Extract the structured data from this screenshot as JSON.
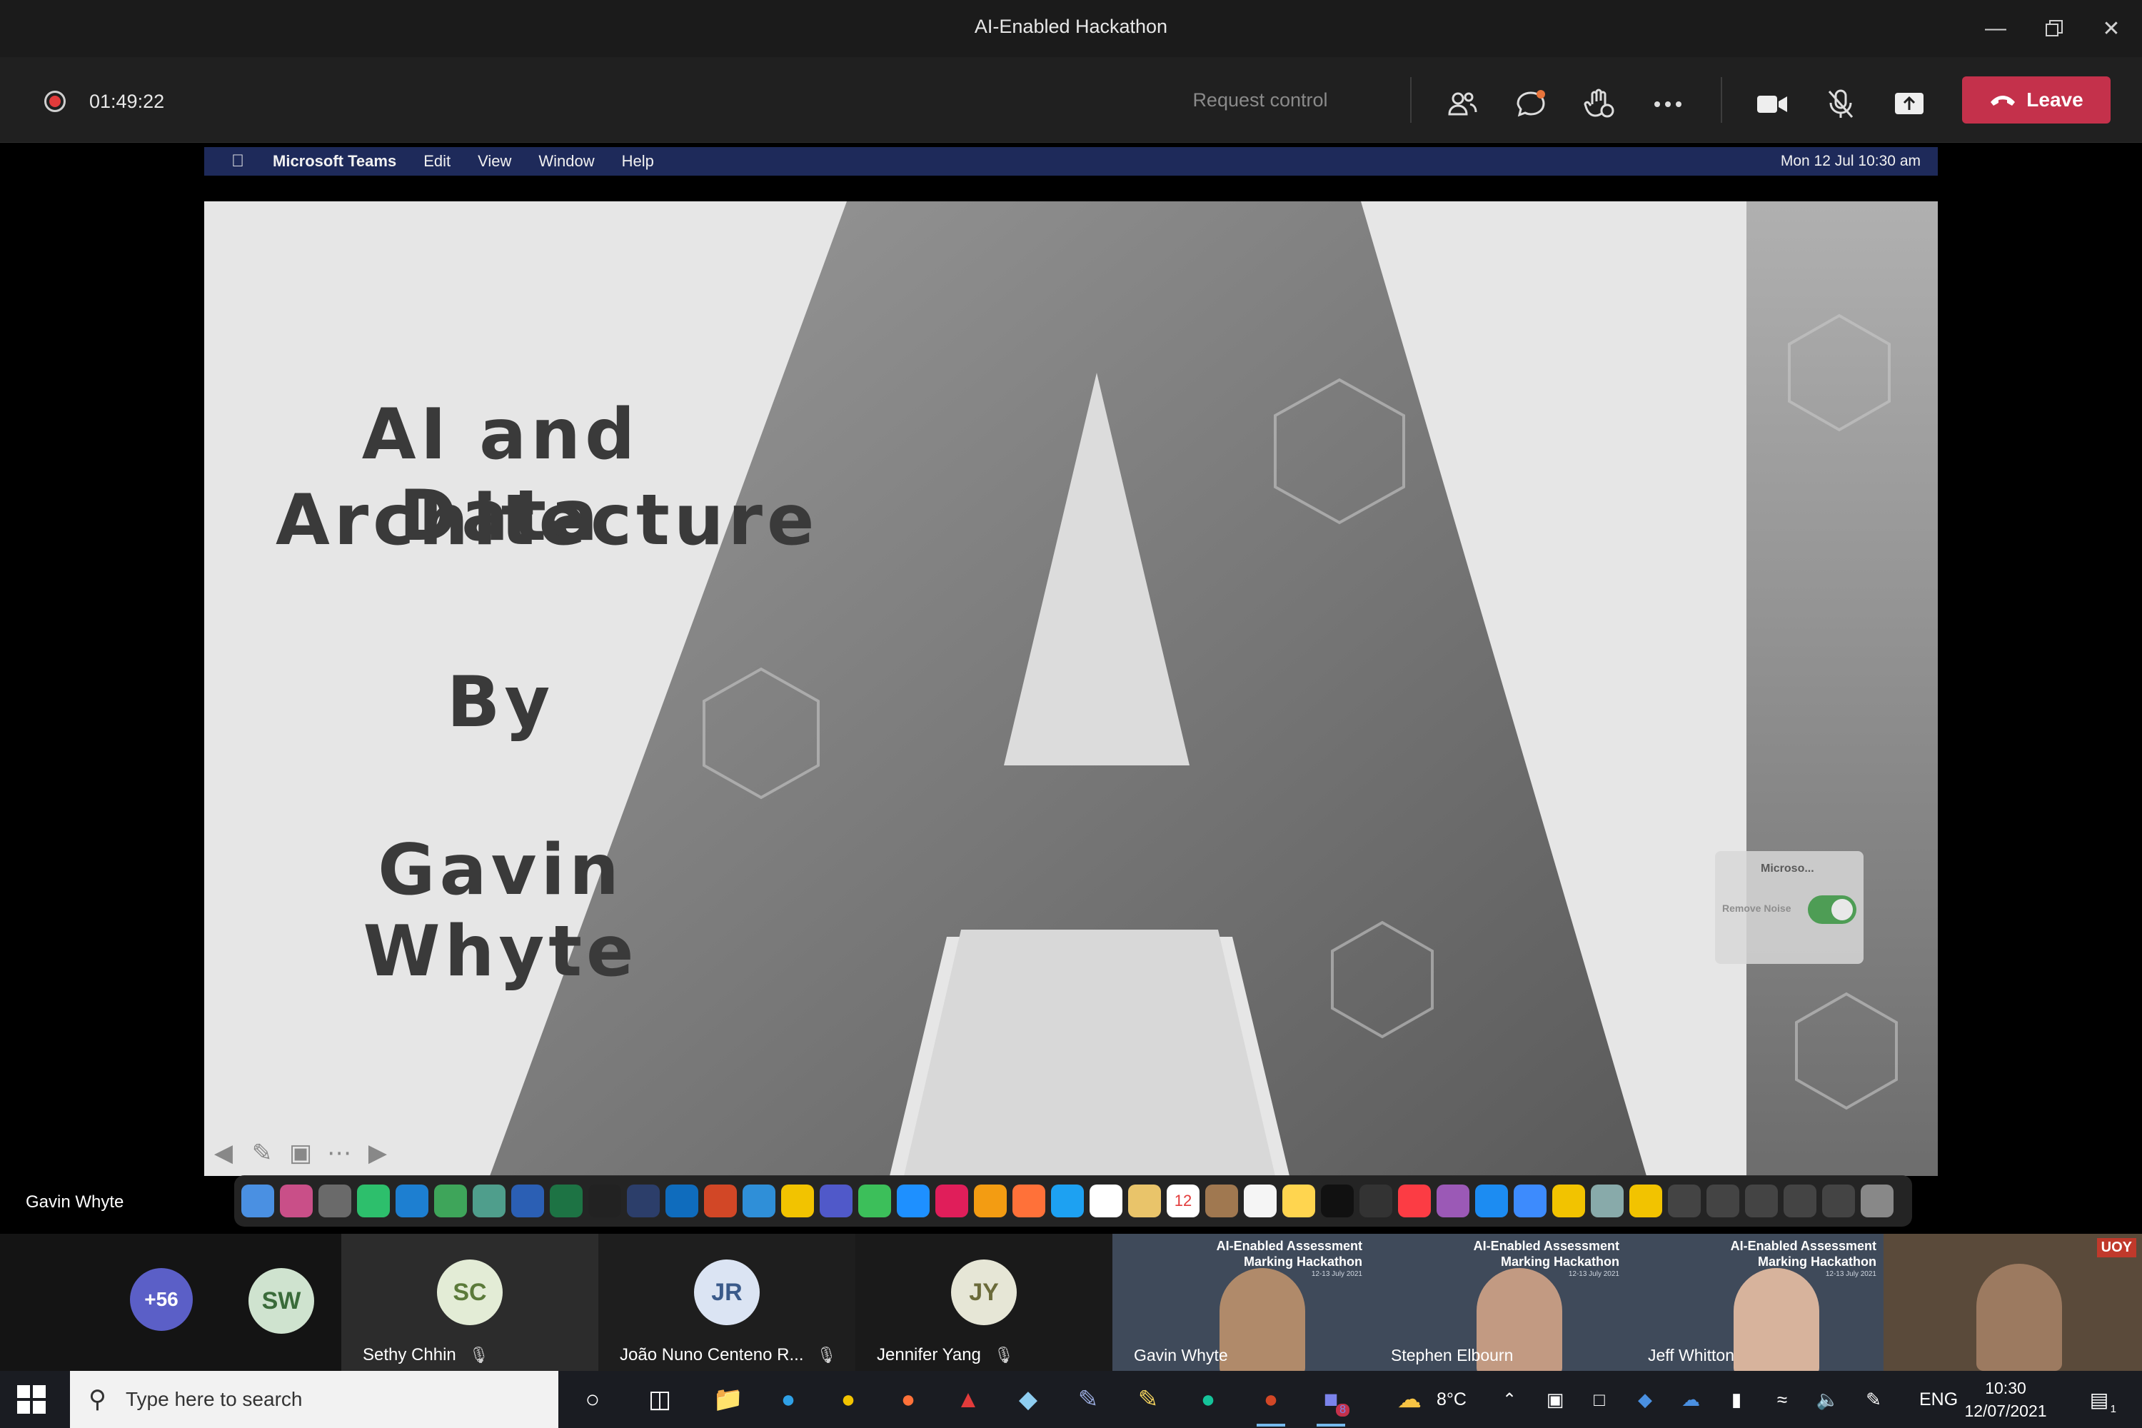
{
  "window": {
    "title": "AI-Enabled Hackathon",
    "controls": [
      "minimize-icon",
      "restore-icon",
      "close-icon"
    ]
  },
  "toolbar": {
    "recording_time": "01:49:22",
    "request_control": "Request control",
    "leave_label": "Leave",
    "icons": [
      "participants-icon",
      "chat-icon",
      "reactions-icon",
      "more-options-icon",
      "camera-icon",
      "mic-muted-icon",
      "share-screen-icon"
    ],
    "leave_color": "#c4314b"
  },
  "shared_screen": {
    "mac_menubar": {
      "app": "Microsoft Teams",
      "menus": [
        "Edit",
        "View",
        "Window",
        "Help"
      ],
      "datetime": "Mon 12 Jul 10:30 am"
    },
    "slide": {
      "title_line1": "AI and Data",
      "title_line2": "Architecture",
      "by": "By",
      "author": "Gavin Whyte"
    },
    "noise_panel": {
      "app": "Microso...",
      "label": "Remove Noise"
    },
    "dock_badge": "12",
    "speaker_name": "Gavin Whyte"
  },
  "participants": {
    "overflow": "+56",
    "tiles": [
      {
        "initials": "SW",
        "name": ""
      },
      {
        "initials": "SC",
        "name": "Sethy Chhin"
      },
      {
        "initials": "JR",
        "name": "João Nuno Centeno R..."
      },
      {
        "initials": "JY",
        "name": "Jennifer Yang"
      }
    ],
    "videos": [
      {
        "name": "Gavin Whyte",
        "banner_title": "AI-Enabled Assessment",
        "banner_line2": "Marking Hackathon",
        "banner_dates": "12-13 July 2021"
      },
      {
        "name": "Stephen Elbourn",
        "banner_title": "AI-Enabled Assessment",
        "banner_line2": "Marking Hackathon",
        "banner_dates": "12-13 July 2021"
      },
      {
        "name": "Jeff Whitton",
        "banner_title": "AI-Enabled Assessment",
        "banner_line2": "Marking Hackathon",
        "banner_dates": "12-13 July 2021"
      },
      {
        "name": "",
        "badge": "UOY"
      }
    ]
  },
  "taskbar": {
    "search_placeholder": "Type here to search",
    "weather": "8°C",
    "language": "ENG",
    "time": "10:30",
    "date": "12/07/2021",
    "teams_badge": "8",
    "notification_count": "1"
  }
}
